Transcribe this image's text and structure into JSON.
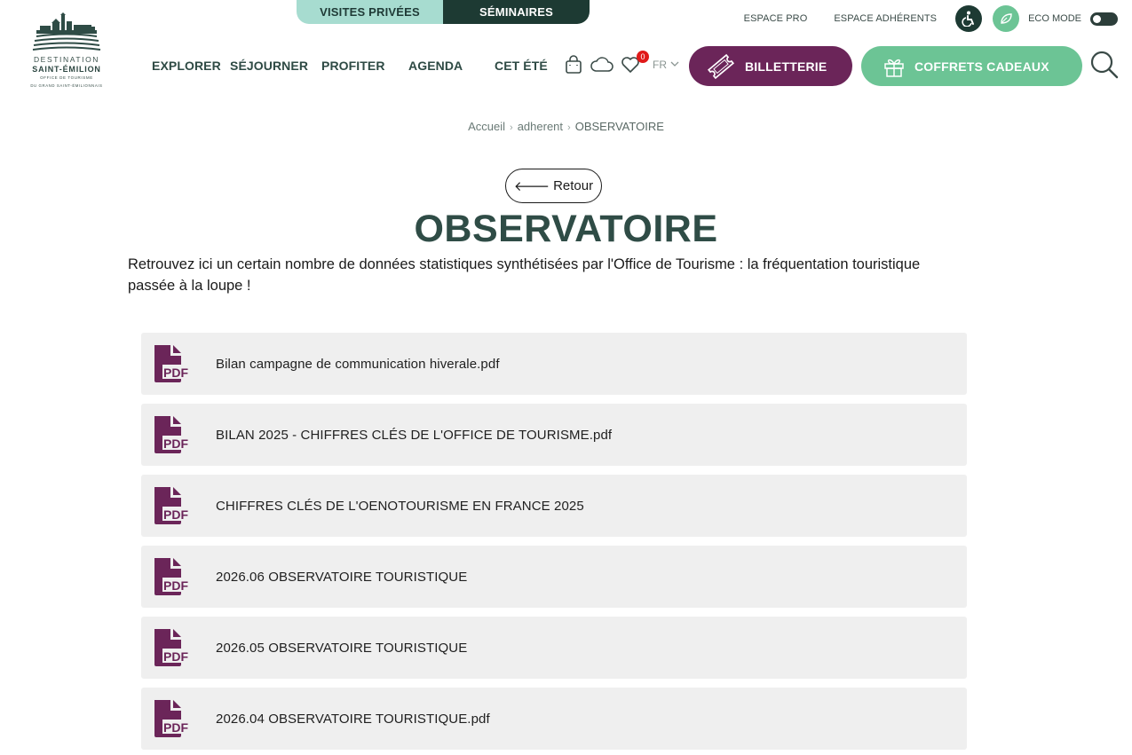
{
  "top_tabs": [
    {
      "label": "VISITES PRIVÉES"
    },
    {
      "label": "SÉMINAIRES"
    }
  ],
  "logo": {
    "line1": "DESTINATION",
    "line2": "SAINT-ÉMILION",
    "line3": "OFFICE DE TOURISME",
    "line4": "DU GRAND SAINT-ÉMILIONNAIS"
  },
  "utility": {
    "espace_pro": "ESPACE PRO",
    "espace_adherents": "ESPACE ADHÉRENTS",
    "accessibility_icon": "accessibility-icon",
    "eco_icon": "leaf-icon",
    "eco_mode_label": "ECO MODE"
  },
  "nav": {
    "items": [
      {
        "label": "EXPLORER"
      },
      {
        "label": "SÉJOURNER"
      },
      {
        "label": "PROFITER"
      },
      {
        "label": "AGENDA"
      },
      {
        "label": "CET ÉTÉ"
      }
    ],
    "favorites_count": "0",
    "language": "FR",
    "billetterie": "BILLETTERIE",
    "coffrets": "COFFRETS CADEAUX"
  },
  "breadcrumb": {
    "home": "Accueil",
    "parent": "adherent",
    "current": "OBSERVATOIRE"
  },
  "back_label": "Retour",
  "page": {
    "title": "OBSERVATOIRE",
    "intro": "Retrouvez ici un certain nombre de données statistiques synthétisées par l'Office de Tourisme : la fréquentation touristique passée à la loupe !"
  },
  "documents": [
    {
      "name": "Bilan campagne de communication hiverale.pdf"
    },
    {
      "name": "BILAN 2025 - CHIFFRES CLÉS DE L'OFFICE DE TOURISME.pdf"
    },
    {
      "name": "CHIFFRES CLÉS DE L'OENOTOURISME EN FRANCE 2025"
    },
    {
      "name": "2026.06 OBSERVATOIRE TOURISTIQUE"
    },
    {
      "name": "2026.05 OBSERVATOIRE TOURISTIQUE"
    },
    {
      "name": "2026.04 OBSERVATOIRE TOURISTIQUE.pdf"
    }
  ],
  "colors": {
    "brand_dark": "#1d3a33",
    "brand_light": "#a7dcd0",
    "billetterie": "#6b2559",
    "coffrets": "#6cc495",
    "pdf_icon": "#6b2559"
  }
}
